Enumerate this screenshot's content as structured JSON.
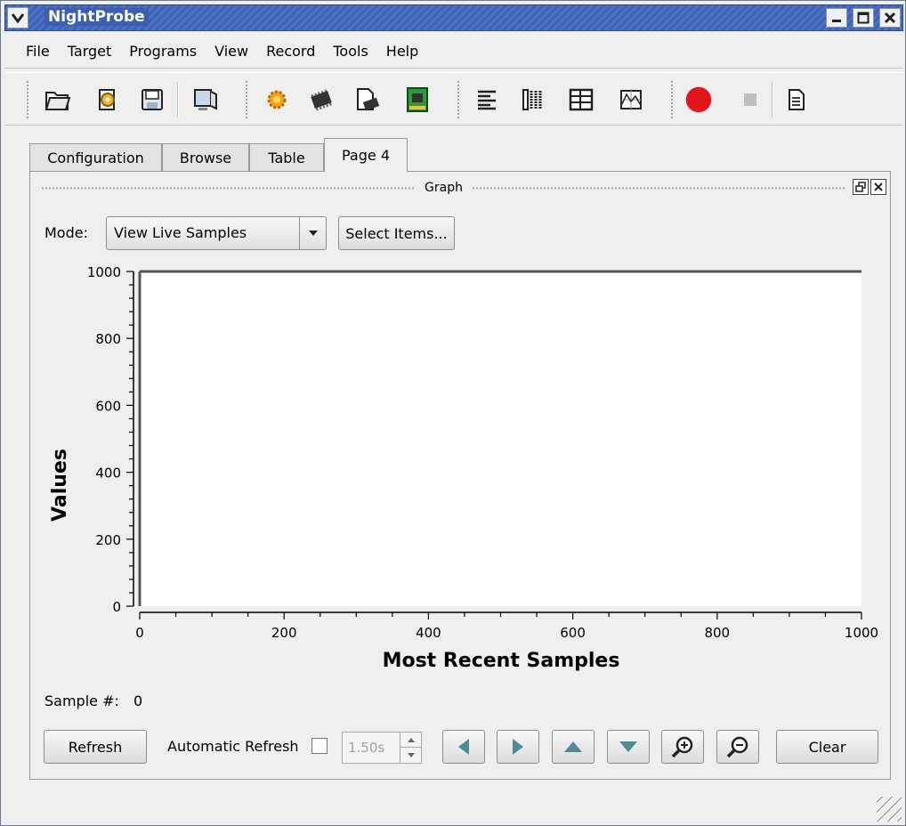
{
  "window": {
    "title": "NightProbe"
  },
  "menu": [
    "File",
    "Target",
    "Programs",
    "View",
    "Record",
    "Tools",
    "Help"
  ],
  "toolbar": {
    "icons": [
      "open-folder-icon",
      "target-config-icon",
      "save-icon",
      "monitor-icon",
      "program-gear-icon",
      "chip-icon",
      "chip-document-icon",
      "circuit-board-icon",
      "text-view-icon",
      "columns-view-icon",
      "table-view-icon",
      "graph-view-icon",
      "record-icon",
      "stop-icon",
      "report-icon"
    ],
    "colors": {
      "record": "#e3141c",
      "stop": "#bdbdbd"
    }
  },
  "tabs": [
    {
      "label": "Configuration",
      "active": false
    },
    {
      "label": "Browse",
      "active": false
    },
    {
      "label": "Table",
      "active": false
    },
    {
      "label": "Page 4",
      "active": true
    }
  ],
  "graph_panel": {
    "title": "Graph",
    "mode_label": "Mode:",
    "mode_value": "View Live Samples",
    "select_items_label": "Select Items...",
    "sample_label": "Sample #:",
    "sample_value": "0",
    "refresh_label": "Refresh",
    "auto_refresh_label": "Automatic Refresh",
    "auto_refresh_checked": false,
    "interval_value": "1.50s",
    "clear_label": "Clear"
  },
  "chart_data": {
    "type": "line",
    "title": "",
    "xlabel": "Most Recent Samples",
    "ylabel": "Values",
    "xlim": [
      0,
      1000
    ],
    "ylim": [
      0,
      1000
    ],
    "x_ticks": [
      0,
      200,
      400,
      600,
      800,
      1000
    ],
    "y_ticks": [
      0,
      200,
      400,
      600,
      800,
      1000
    ],
    "series": [],
    "grid": false
  }
}
